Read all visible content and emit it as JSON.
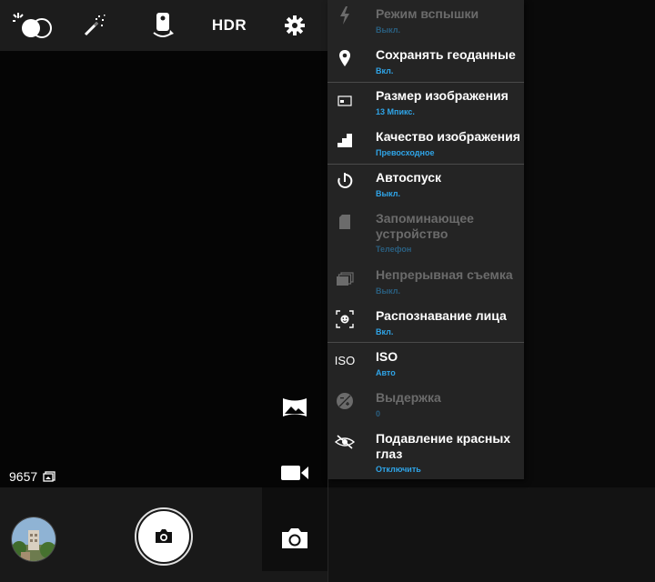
{
  "topbar": {
    "icons": [
      "exposure-icon",
      "magic-wand-icon",
      "camera-switch-icon",
      "hdr-label",
      "gear-icon"
    ],
    "hdr_label": "HDR"
  },
  "viewfinder": {
    "photo_count": "9657"
  },
  "modes": [
    "panorama-icon",
    "video-camera-icon",
    "camera-icon"
  ],
  "menu": {
    "items": [
      {
        "title": "Режим вспышки",
        "value": "Выкл.",
        "enabled": false,
        "icon": "flash-icon"
      },
      {
        "title": "Сохранять геоданные",
        "value": "Вкл.",
        "enabled": true,
        "icon": "location-pin-icon"
      },
      {
        "title": "Размер изображения",
        "value": "13 Мпикс.",
        "enabled": true,
        "icon": "image-size-icon"
      },
      {
        "title": "Качество изображения",
        "value": "Превосходное",
        "enabled": true,
        "icon": "quality-stairs-icon"
      },
      {
        "title": "Автоспуск",
        "value": "Выкл.",
        "enabled": true,
        "icon": "timer-icon"
      },
      {
        "title": "Запоминающее устройство",
        "value": "Телефон",
        "enabled": false,
        "icon": "sd-card-icon"
      },
      {
        "title": "Непрерывная съемка",
        "value": "Выкл.",
        "enabled": false,
        "icon": "burst-icon"
      },
      {
        "title": "Распознавание лица",
        "value": "Вкл.",
        "enabled": true,
        "icon": "face-detect-icon"
      },
      {
        "title": "ISO",
        "value": "Авто",
        "enabled": true,
        "icon": "iso-icon"
      },
      {
        "title": "Выдержка",
        "value": "0",
        "enabled": false,
        "icon": "exposure-comp-icon"
      },
      {
        "title": "Подавление красных глаз",
        "value": "Отключить",
        "enabled": true,
        "icon": "red-eye-icon"
      }
    ],
    "iso_icon_text": "ISO"
  },
  "colors": {
    "accent": "#2fa4e7",
    "menu_bg": "#242424",
    "bar_bg": "#1c1c1c"
  }
}
